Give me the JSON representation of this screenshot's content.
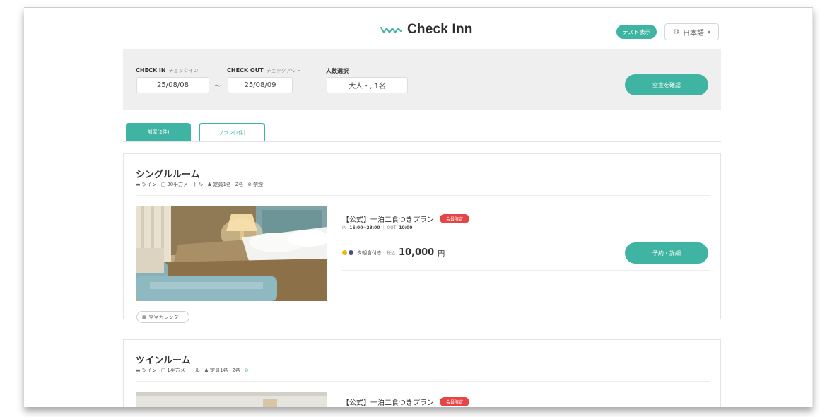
{
  "header": {
    "logo_text": "Check Inn",
    "login_label": "テスト表示",
    "language_label": "日本語"
  },
  "search": {
    "checkin_label": "CHECK IN",
    "checkin_sub": "チェックイン",
    "checkin_value": "25/08/08",
    "separator": "〜",
    "checkout_label": "CHECK OUT",
    "checkout_sub": "チェックアウト",
    "checkout_value": "25/08/09",
    "guests_label": "人数選択",
    "guests_value": "大人・, 1名",
    "check_button": "空室を確認"
  },
  "tabs": {
    "rooms": "部屋(2件)",
    "plans": "プラン(1件)"
  },
  "rooms": [
    {
      "title": "シングルルーム",
      "meta": {
        "bed": "ツイン",
        "size": "30平方メートル",
        "capacity": "定員1名~2名",
        "smoking": "禁煙"
      },
      "calendar_label": "空室カレンダー",
      "plan": {
        "name": "【公式】一泊二食つきプラン",
        "badge": "会員限定",
        "in_label": "IN",
        "in_time": "16:00~23:00",
        "out_label": "OUT",
        "out_time": "10:00",
        "meal": "夕朝食付き",
        "tax": "税込",
        "price": "10,000",
        "currency": "円",
        "reserve_button": "予約・詳細"
      }
    },
    {
      "title": "ツインルーム",
      "meta": {
        "bed": "ツイン",
        "size": "1平方メートル",
        "capacity": "定員1名~2名"
      },
      "plan": {
        "name": "【公式】一泊二食つきプラン",
        "badge": "会員限定"
      }
    }
  ],
  "colors": {
    "accent": "#3fb4a2",
    "badge": "#e64545",
    "panel": "#efefef"
  }
}
